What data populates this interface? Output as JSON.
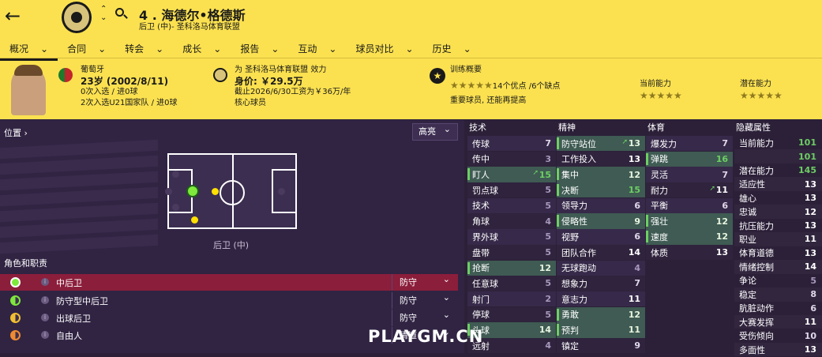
{
  "header": {
    "number": "4 .",
    "name": "海德尔•格德斯",
    "sub": "后卫 (中)- 圣科洛马体育联盟"
  },
  "nav": [
    "概况",
    "合同",
    "转会",
    "成长",
    "报告",
    "互动",
    "球员对比",
    "历史"
  ],
  "player": {
    "nation": "葡萄牙",
    "age": "23岁 (2002/8/11)",
    "caps1": "0次入选 / 进0球",
    "caps2": "2次入选U21国家队 / 进0球"
  },
  "club": {
    "line": "为 圣科洛马体育联盟 效力",
    "value_label": "身价:",
    "value": "￥29.5万",
    "contract": "截止2026/6/30工资为￥36万/年",
    "status": "核心球员"
  },
  "training": {
    "title": "训练概要",
    "stars_summary": "★★★★★",
    "pros": "14个优点 /6个缺点",
    "note": "重要球员, 还能再提高",
    "ca_label": "当前能力",
    "pa_label": "潜在能力",
    "ca_stars": "★★★★★",
    "pa_stars": "★★★★★"
  },
  "position": {
    "title": "位置 ›",
    "filter": "高亮",
    "label": "后卫 (中)"
  },
  "roles": {
    "title": "角色和职责",
    "items": [
      {
        "name": "中后卫",
        "duty": "防守"
      },
      {
        "name": "防守型中后卫",
        "duty": "防守"
      },
      {
        "name": "出球后卫",
        "duty": "防守"
      },
      {
        "name": "自由人",
        "duty": "清道"
      }
    ]
  },
  "tech": {
    "title": "技术",
    "rows": [
      [
        "传球",
        "7"
      ],
      [
        "传中",
        "3"
      ],
      [
        "盯人",
        "15"
      ],
      [
        "罚点球",
        "5"
      ],
      [
        "技术",
        "5"
      ],
      [
        "角球",
        "4"
      ],
      [
        "界外球",
        "5"
      ],
      [
        "盘带",
        "5"
      ],
      [
        "抢断",
        "12"
      ],
      [
        "任意球",
        "5"
      ],
      [
        "射门",
        "2"
      ],
      [
        "停球",
        "5"
      ],
      [
        "头球",
        "14"
      ],
      [
        "远射",
        "4"
      ]
    ]
  },
  "mental": {
    "title": "精神",
    "rows": [
      [
        "防守站位",
        "13"
      ],
      [
        "工作投入",
        "13"
      ],
      [
        "集中",
        "12"
      ],
      [
        "决断",
        "15"
      ],
      [
        "领导力",
        "6"
      ],
      [
        "侵略性",
        "9"
      ],
      [
        "视野",
        "6"
      ],
      [
        "团队合作",
        "14"
      ],
      [
        "无球跑动",
        "4"
      ],
      [
        "想象力",
        "7"
      ],
      [
        "意志力",
        "11"
      ],
      [
        "勇敢",
        "12"
      ],
      [
        "预判",
        "11"
      ],
      [
        "镇定",
        "9"
      ]
    ]
  },
  "physical": {
    "title": "体育",
    "rows": [
      [
        "爆发力",
        "7"
      ],
      [
        "弹跳",
        "16"
      ],
      [
        "灵活",
        "7"
      ],
      [
        "耐力",
        "11"
      ],
      [
        "平衡",
        "6"
      ],
      [
        "强壮",
        "12"
      ],
      [
        "速度",
        "12"
      ],
      [
        "体质",
        "13"
      ]
    ]
  },
  "hidden": {
    "title": "隐藏属性",
    "rows": [
      [
        "当前能力",
        "101"
      ],
      [
        "",
        "101"
      ],
      [
        "潜在能力",
        "145"
      ],
      [
        "适应性",
        "13"
      ],
      [
        "雄心",
        "13"
      ],
      [
        "忠诚",
        "12"
      ],
      [
        "抗压能力",
        "13"
      ],
      [
        "职业",
        "11"
      ],
      [
        "体育道德",
        "13"
      ],
      [
        "情绪控制",
        "14"
      ],
      [
        "争论",
        "5"
      ],
      [
        "稳定",
        "8"
      ],
      [
        "肮脏动作",
        "6"
      ],
      [
        "大赛发挥",
        "11"
      ],
      [
        "受伤倾向",
        "10"
      ],
      [
        "多面性",
        "13"
      ]
    ]
  },
  "watermark": "PLAYGM.CN"
}
